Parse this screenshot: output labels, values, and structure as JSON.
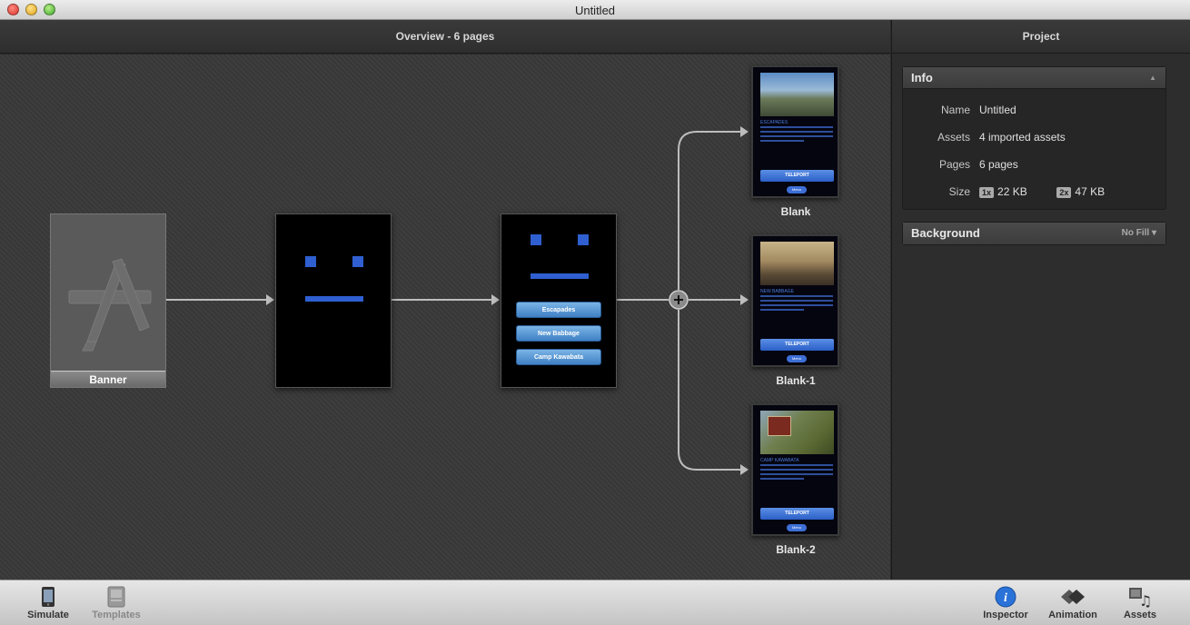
{
  "window": {
    "title": "Untitled"
  },
  "canvas": {
    "header": "Overview - 6 pages"
  },
  "banner": {
    "label": "Banner"
  },
  "menu_page": {
    "buttons": [
      "Escapades",
      "New Babbage",
      "Camp Kawabata"
    ]
  },
  "thumbs": [
    {
      "label": "Blank",
      "heading": "ESCAPADES",
      "teleport": "TELEPORT",
      "menu": "Menu"
    },
    {
      "label": "Blank-1",
      "heading": "NEW BABBAGE",
      "teleport": "TELEPORT",
      "menu": "Menu"
    },
    {
      "label": "Blank-2",
      "heading": "CAMP KAWABATA",
      "teleport": "TELEPORT",
      "menu": "Menu"
    }
  ],
  "panel": {
    "header": "Project",
    "info": {
      "title": "Info",
      "rows": [
        {
          "key": "Name",
          "value": "Untitled"
        },
        {
          "key": "Assets",
          "value": "4 imported assets"
        },
        {
          "key": "Pages",
          "value": "6 pages"
        }
      ],
      "size": {
        "key": "Size",
        "badge1": "1x",
        "val1": "22 KB",
        "badge2": "2x",
        "val2": "47 KB"
      }
    },
    "background": {
      "title": "Background",
      "value": "No Fill ▾"
    }
  },
  "toolbar": {
    "simulate": "Simulate",
    "templates": "Templates",
    "inspector": "Inspector",
    "animation": "Animation",
    "assets": "Assets"
  },
  "colors": {
    "accent_blue": "#2f5fd0",
    "canvas_bg": "#393939"
  }
}
